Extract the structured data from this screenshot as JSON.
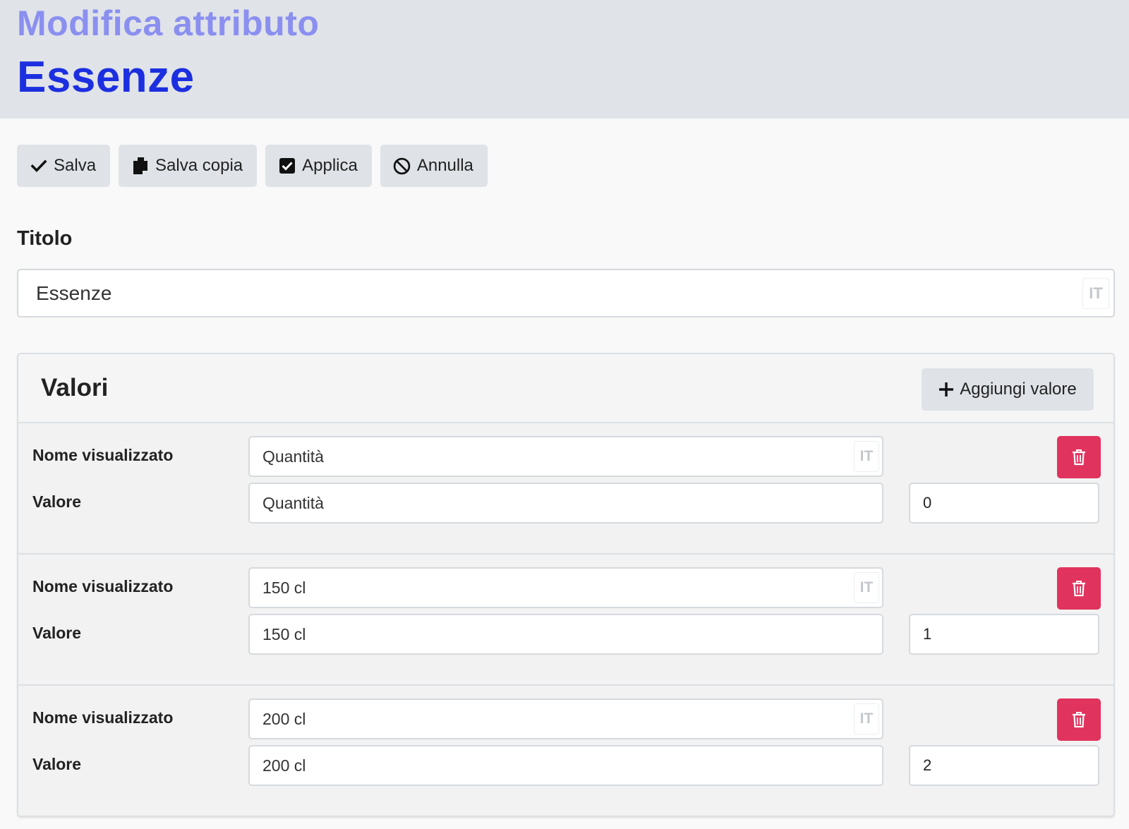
{
  "header": {
    "subtitle": "Modifica attributo",
    "title": "Essenze"
  },
  "toolbar": {
    "save_label": "Salva",
    "save_copy_label": "Salva copia",
    "apply_label": "Applica",
    "cancel_label": "Annulla"
  },
  "title_field": {
    "label": "Titolo",
    "value": "Essenze",
    "lang": "IT"
  },
  "values_section": {
    "title": "Valori",
    "add_label": "Aggiungi valore",
    "display_name_label": "Nome visualizzato",
    "value_label": "Valore",
    "items": [
      {
        "display_name": "Quantità",
        "lang": "IT",
        "value": "Quantità",
        "order": "0"
      },
      {
        "display_name": "150 cl",
        "lang": "IT",
        "value": "150 cl",
        "order": "1"
      },
      {
        "display_name": "200 cl",
        "lang": "IT",
        "value": "200 cl",
        "order": "2"
      }
    ]
  },
  "colors": {
    "subtitle": "#8a8ff0",
    "title": "#1c2fe0",
    "delete": "#e0335d",
    "button_bg": "#dfe2e7"
  },
  "icons": {
    "save": "check-icon",
    "save_copy": "copy-icon",
    "apply": "checkbox-icon",
    "cancel": "ban-icon",
    "add": "plus-icon",
    "delete": "trash-icon"
  }
}
